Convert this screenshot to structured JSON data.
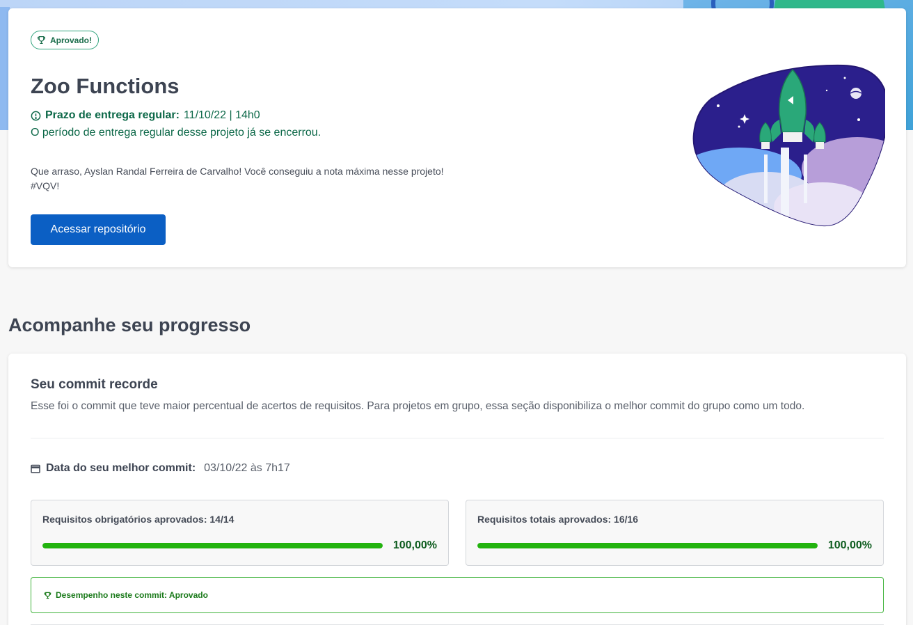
{
  "project": {
    "badge": "Aprovado!",
    "title": "Zoo Functions",
    "deadline_label": "Prazo de entrega regular:",
    "deadline_value": "11/10/22 | 14h0",
    "deadline_note": "O período de entrega regular desse projeto já se encerrou.",
    "congrats_line1": "Que arraso, Ayslan Randal Ferreira de Carvalho! Você conseguiu a nota máxima nesse projeto!",
    "congrats_line2": "#VQV!",
    "repo_button": "Acessar repositório"
  },
  "progress": {
    "section_title": "Acompanhe seu progresso",
    "commit_title": "Seu commit recorde",
    "commit_desc": "Esse foi o commit que teve maior percentual de acertos de requisitos. Para projetos em grupo, essa seção disponibiliza o melhor commit do grupo como um todo.",
    "best_date_label": "Data do seu melhor commit:",
    "best_date_value": "03/10/22 às 7h17",
    "mandatory": {
      "label": "Requisitos obrigatórios aprovados: 14/14",
      "percent_text": "100,00%",
      "fraction": 1.0
    },
    "total": {
      "label": "Requisitos totais aprovados: 16/16",
      "percent_text": "100,00%",
      "fraction": 1.0
    },
    "performance": "Desempenho neste commit: Aprovado"
  },
  "colors": {
    "accent_blue": "#0b5fc4",
    "success_green": "#22b30e",
    "approved_text": "#0c6848"
  },
  "icons": {
    "badge": "trophy-icon",
    "deadline": "alert-circle-icon",
    "date": "calendar-icon",
    "performance": "trophy-icon"
  }
}
